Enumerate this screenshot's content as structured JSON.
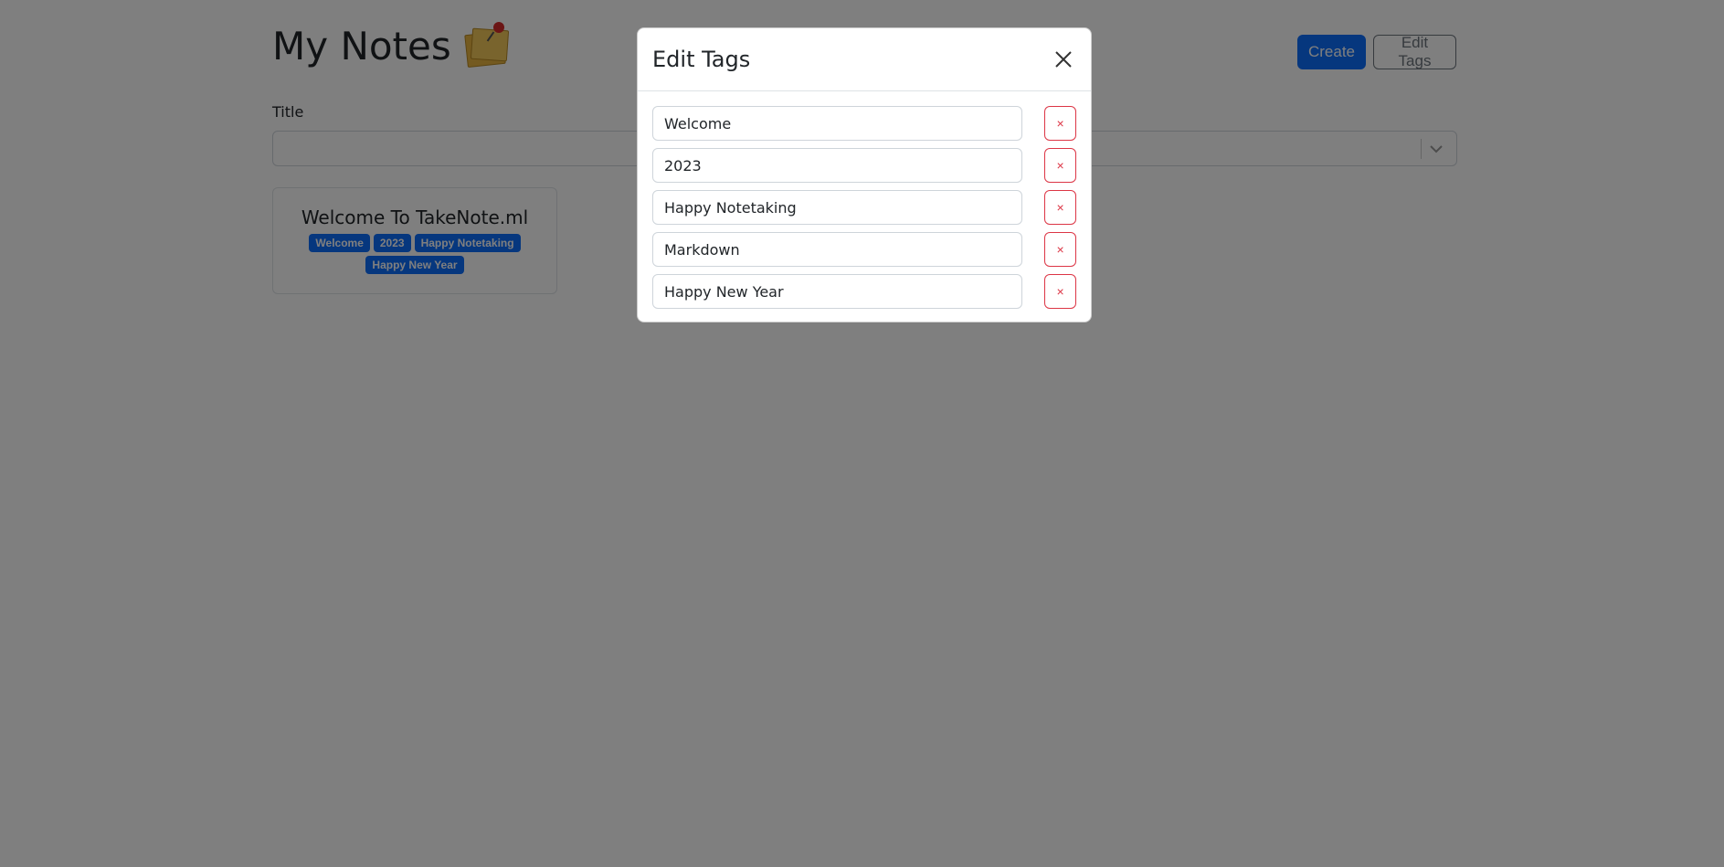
{
  "page": {
    "title": "My Notes",
    "title_icon": "memo-pushpin-icon",
    "actions": {
      "create_label": "Create",
      "edit_tags_label": "Edit Tags"
    },
    "filter": {
      "title_label": "Title"
    }
  },
  "notes": [
    {
      "title": "Welcome To TakeNote.ml",
      "tags": [
        "Welcome",
        "2023",
        "Happy Notetaking",
        "Happy New Year"
      ]
    }
  ],
  "modal": {
    "title": "Edit Tags",
    "close_icon": "close-icon",
    "delete_label": "×",
    "tags": [
      "Welcome",
      "2023",
      "Happy Notetaking",
      "Markdown",
      "Happy New Year"
    ]
  },
  "colors": {
    "primary": "#0d6efd",
    "danger": "#dc3545",
    "backdrop": "rgba(0,0,0,0.5)"
  }
}
